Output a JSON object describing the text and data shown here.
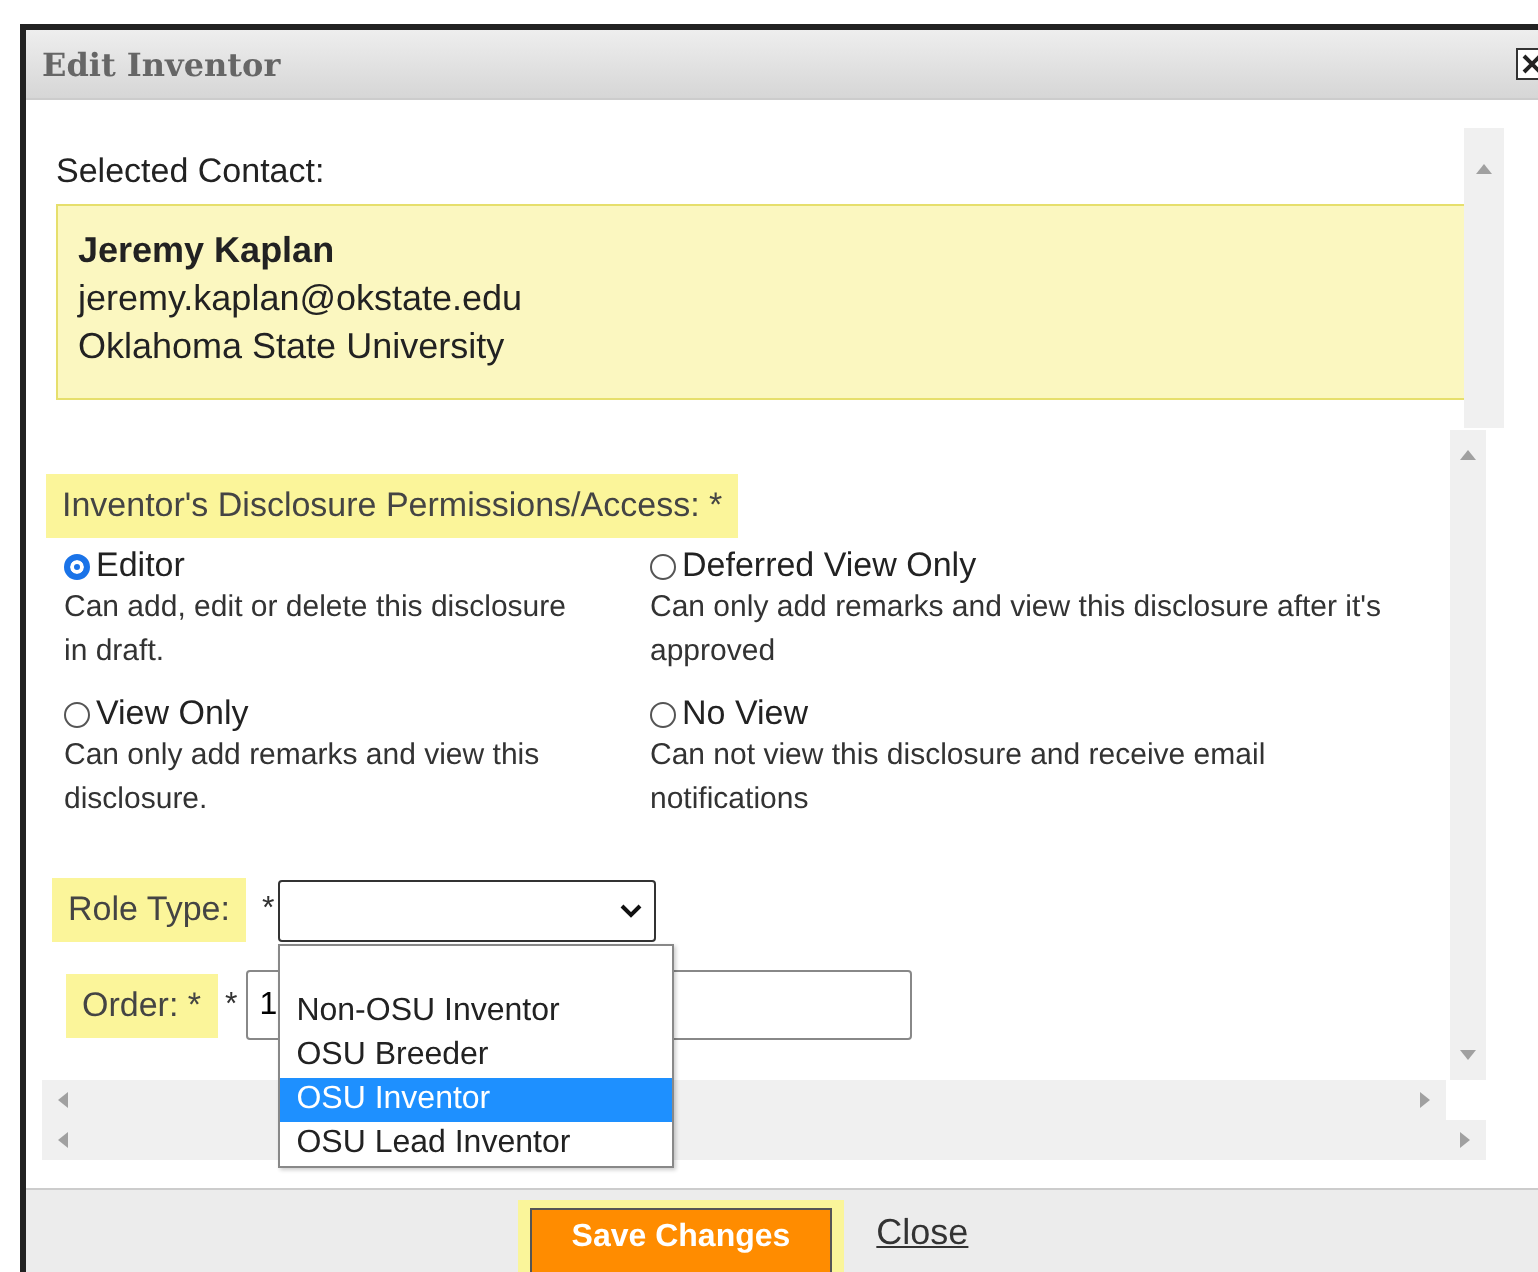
{
  "window": {
    "title": "Edit Inventor"
  },
  "selected_contact": {
    "label": "Selected Contact:",
    "name": "Jeremy Kaplan",
    "email": "jeremy.kaplan@okstate.edu",
    "organization": "Oklahoma State University"
  },
  "permissions": {
    "label": "Inventor's Disclosure Permissions/Access: *",
    "options": [
      {
        "label": "Editor",
        "description": "Can add, edit or delete this disclosure in draft.",
        "selected": true
      },
      {
        "label": "Deferred View Only",
        "description": "Can only add remarks and view this disclosure after it's approved",
        "selected": false
      },
      {
        "label": "View Only",
        "description": "Can only add remarks and view this disclosure.",
        "selected": false
      },
      {
        "label": "No View",
        "description": "Can not view this disclosure and receive email notifications",
        "selected": false
      }
    ]
  },
  "role_type": {
    "label": "Role Type:",
    "required_mark": "*",
    "expanded": true,
    "options": [
      {
        "label": "Non-OSU Inventor",
        "selected": false
      },
      {
        "label": "OSU Breeder",
        "selected": false
      },
      {
        "label": "OSU Inventor",
        "selected": true
      },
      {
        "label": "OSU Lead Inventor",
        "selected": false
      }
    ]
  },
  "order": {
    "label": "Order: *",
    "required_mark": "*",
    "value": "1"
  },
  "buttons": [
    {
      "label": "Save Changes",
      "kind": "primary"
    },
    {
      "label": "Close",
      "kind": "link"
    }
  ]
}
